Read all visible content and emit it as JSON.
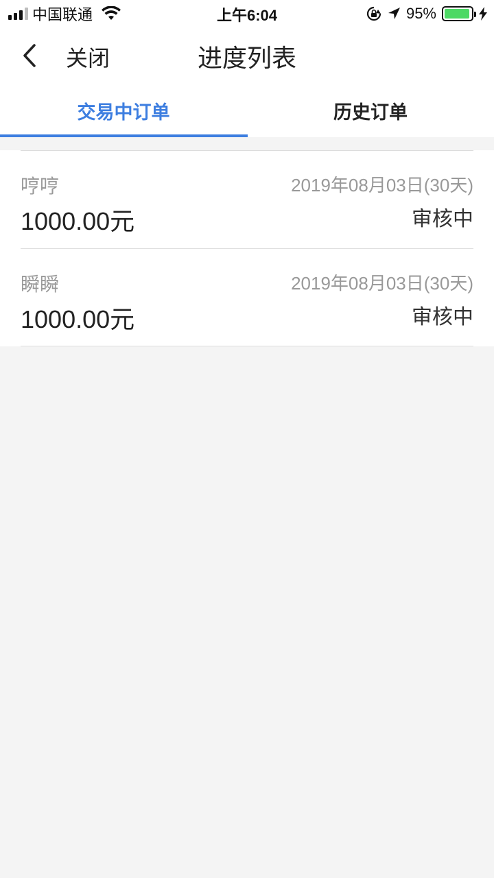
{
  "status_bar": {
    "carrier": "中国联通",
    "time": "上午6:04",
    "battery_pct": "95%",
    "battery_level": 0.95,
    "battery_color": "#4cd964"
  },
  "nav": {
    "back_icon": "chevron-left-icon",
    "close_label": "关闭",
    "title": "进度列表"
  },
  "tabs": [
    {
      "label": "交易中订单",
      "active": true
    },
    {
      "label": "历史订单",
      "active": false
    }
  ],
  "accent_color": "#3d7ee0",
  "orders": [
    {
      "name": "哼哼",
      "amount": "1000.00元",
      "date": "2019年08月03日(30天)",
      "status": "审核中"
    },
    {
      "name": "瞬瞬",
      "amount": "1000.00元",
      "date": "2019年08月03日(30天)",
      "status": "审核中"
    }
  ]
}
